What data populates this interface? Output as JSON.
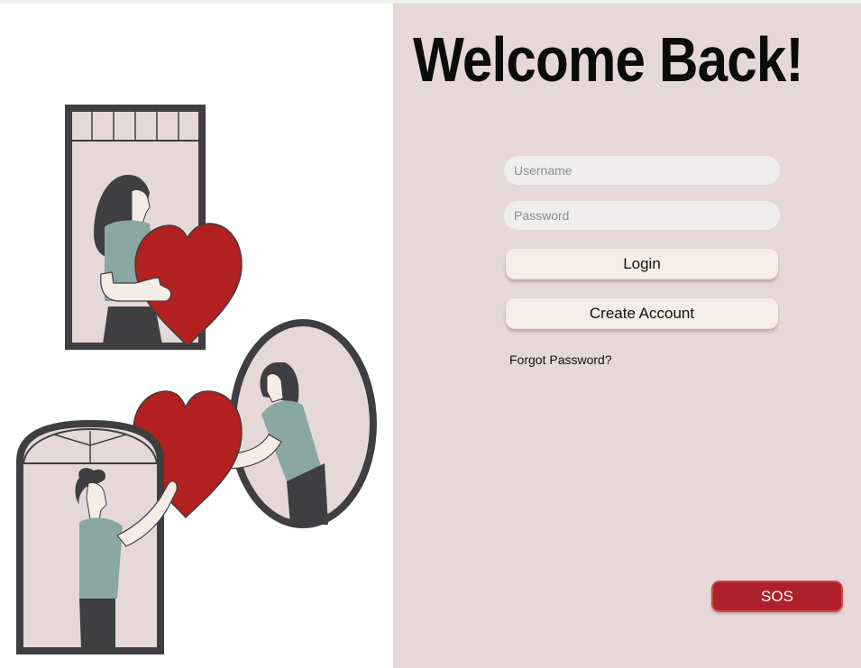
{
  "page": {
    "title": "Welcome Back!"
  },
  "login_form": {
    "username_placeholder": "Username",
    "password_placeholder": "Password",
    "login_label": "Login",
    "create_account_label": "Create Account",
    "forgot_password_label": "Forgot Password?"
  },
  "sos": {
    "label": "SOS"
  },
  "colors": {
    "panel_background": "#e6d8d8",
    "button_background": "#f6ece8",
    "sos_red": "#b0202a",
    "heart_red": "#b22020",
    "frame_dark": "#3f3e40",
    "shirt_teal": "#8aa7a2"
  }
}
